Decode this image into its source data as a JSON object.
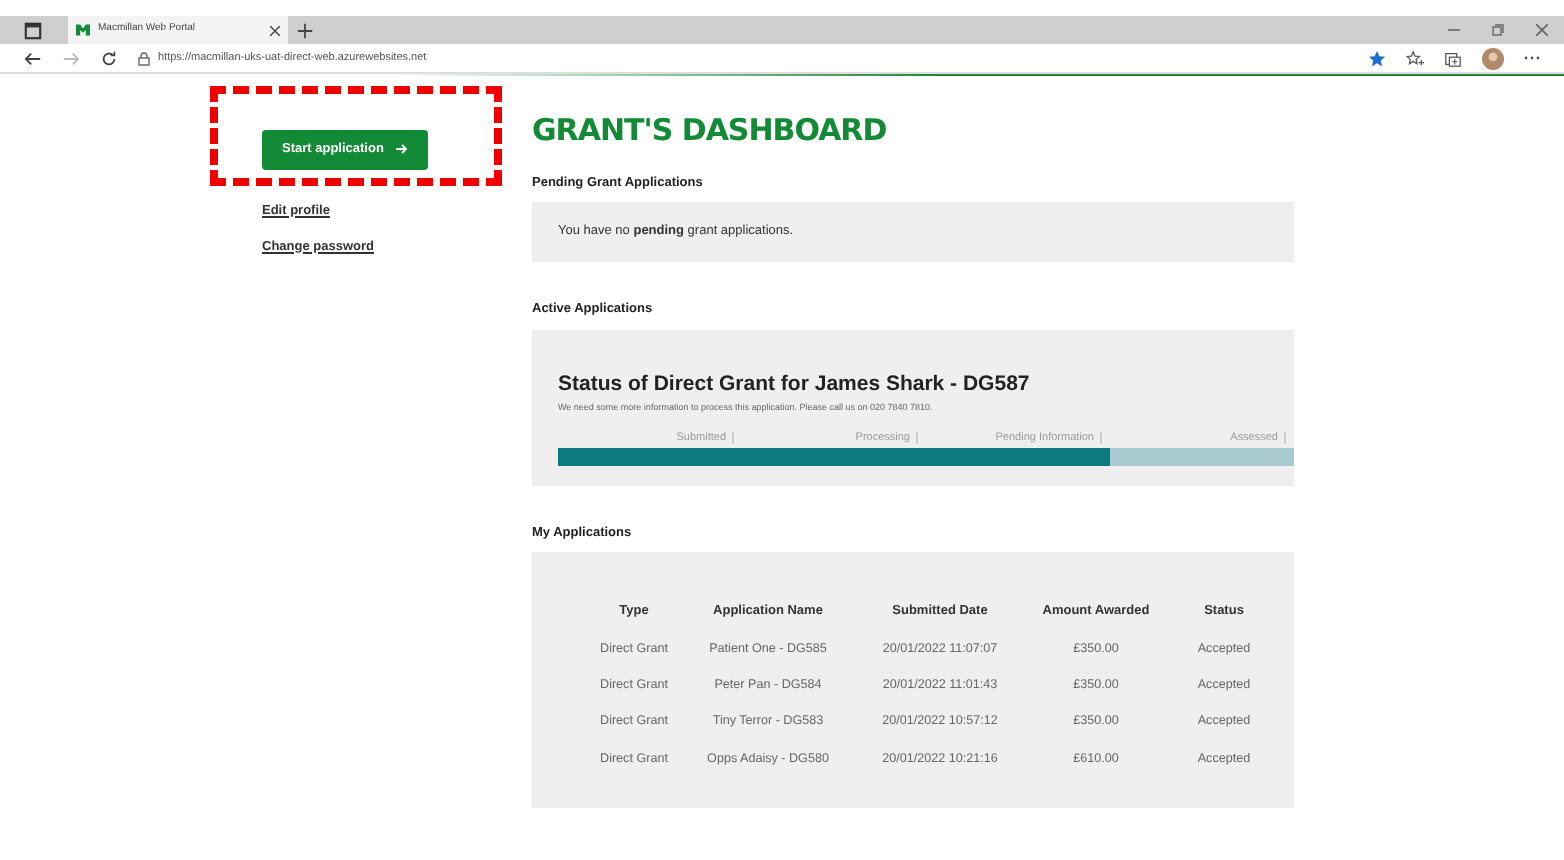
{
  "browser": {
    "tab_title": "Macmillan Web Portal",
    "url": "https://macmillan-uks-uat-direct-web.azurewebsites.net"
  },
  "sidebar": {
    "primary_button": "Start application",
    "links": [
      "Edit profile",
      "Change password"
    ]
  },
  "title": "GRANT'S DASHBOARD",
  "pending": {
    "heading": "Pending Grant Applications",
    "message": "You have no **pending** grant applications."
  },
  "active": {
    "heading": "Active Applications",
    "status_title": "Status of Direct Grant for James Shark - DG587",
    "note": "We need some more information to process this application. Please call us on 020 7840 7810.",
    "steps": [
      "Submitted",
      "Processing",
      "Pending Information",
      "Assessed"
    ],
    "progress": {
      "level": 0.75
    }
  },
  "my_applications": {
    "heading": "My Applications",
    "columns": [
      "Type",
      "Application Name",
      "Submitted Date",
      "Amount Awarded",
      "Status"
    ],
    "rows": [
      [
        "Direct Grant",
        "Patient One - DG585",
        "20/01/2022 11:07:07",
        "£350.00",
        "Accepted"
      ],
      [
        "Direct Grant",
        "Peter Pan - DG584",
        "20/01/2022 11:01:43",
        "£350.00",
        "Accepted"
      ],
      [
        "Direct Grant",
        "Tiny Terror - DG583",
        "20/01/2022 10:57:12",
        "£350.00",
        "Accepted"
      ],
      [
        "Direct Grant",
        "Opps Adaisy - DG580",
        "20/01/2022 10:21:16",
        "£610.00",
        "Accepted"
      ]
    ]
  }
}
